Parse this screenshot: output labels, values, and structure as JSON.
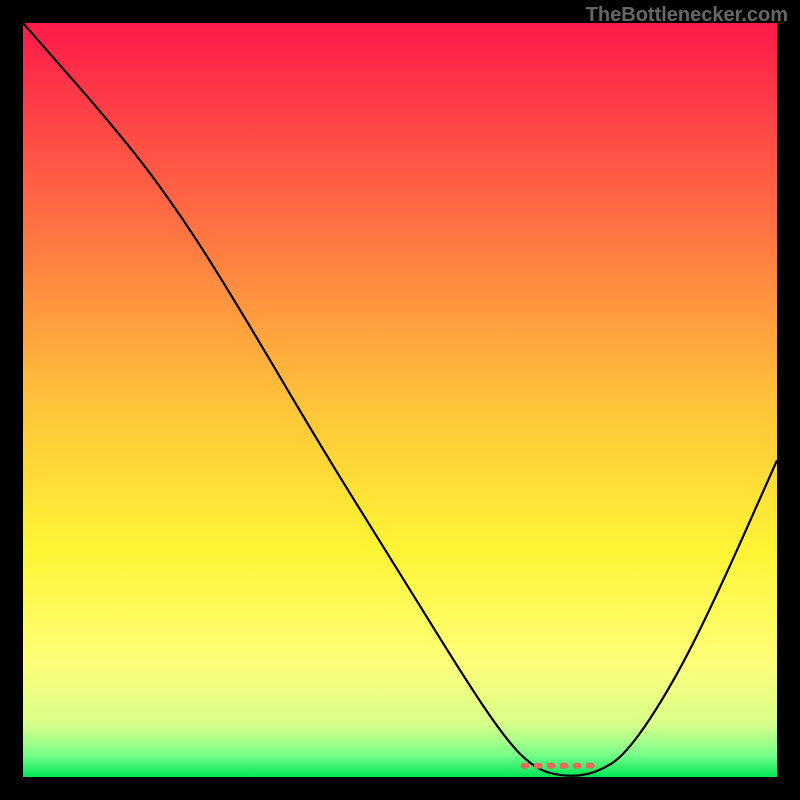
{
  "watermark": "TheBottlenecker.com",
  "chart_data": {
    "type": "line",
    "title": "",
    "xlabel": "",
    "ylabel": "",
    "xlim": [
      0,
      100
    ],
    "ylim": [
      0,
      100
    ],
    "background_gradient": {
      "stops": [
        {
          "offset": 0,
          "color": "#ff1a4a"
        },
        {
          "offset": 25,
          "color": "#ff6b44"
        },
        {
          "offset": 50,
          "color": "#ffc23a"
        },
        {
          "offset": 70,
          "color": "#fff535"
        },
        {
          "offset": 85,
          "color": "#fdff7a"
        },
        {
          "offset": 93,
          "color": "#d8ff8a"
        },
        {
          "offset": 97,
          "color": "#7aff8a"
        },
        {
          "offset": 100,
          "color": "#00e756"
        }
      ]
    },
    "curve": {
      "description": "V-shaped bottleneck curve with minimum around x=72",
      "points": [
        {
          "x": 0,
          "y": 100
        },
        {
          "x": 14,
          "y": 84
        },
        {
          "x": 22,
          "y": 73
        },
        {
          "x": 30,
          "y": 60
        },
        {
          "x": 40,
          "y": 43
        },
        {
          "x": 50,
          "y": 27
        },
        {
          "x": 58,
          "y": 14
        },
        {
          "x": 64,
          "y": 5
        },
        {
          "x": 68,
          "y": 1
        },
        {
          "x": 72,
          "y": 0
        },
        {
          "x": 76,
          "y": 0.5
        },
        {
          "x": 80,
          "y": 3
        },
        {
          "x": 86,
          "y": 12
        },
        {
          "x": 92,
          "y": 24
        },
        {
          "x": 100,
          "y": 42
        }
      ]
    },
    "marker": {
      "x_start": 66,
      "x_end": 76,
      "y": 1.5,
      "color": "#e86a5a",
      "style": "dashed-segment"
    }
  }
}
